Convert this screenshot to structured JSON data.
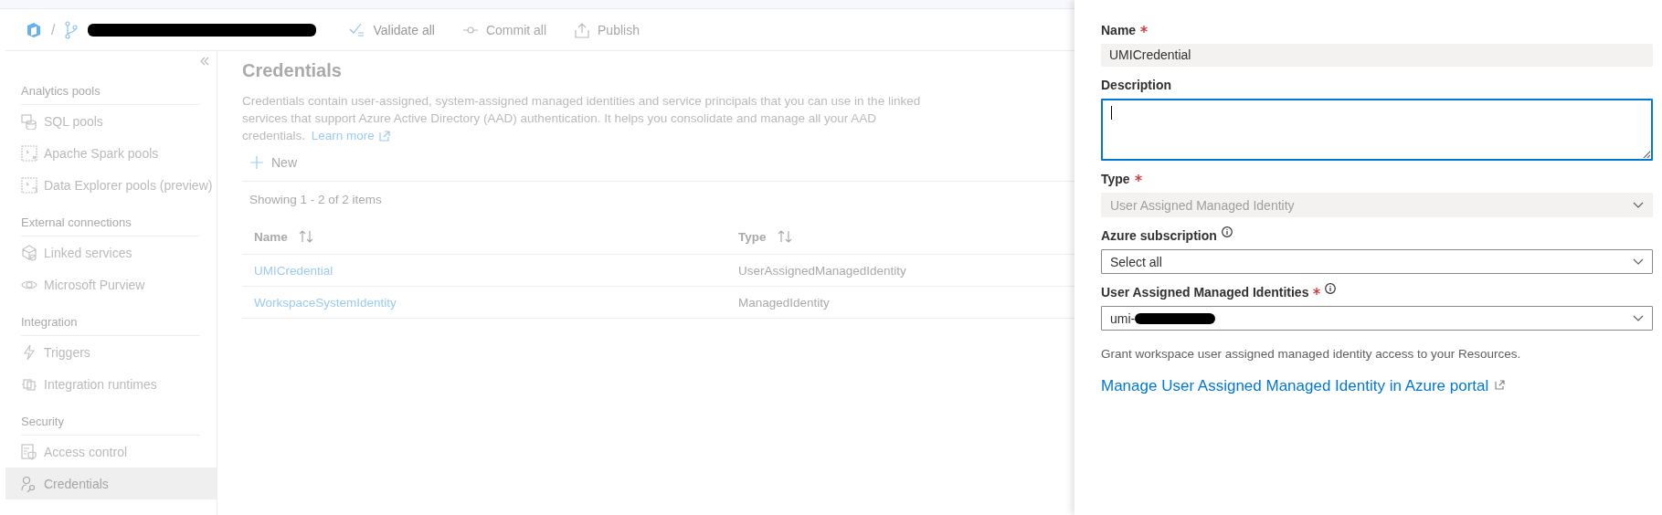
{
  "toolbar": {
    "separator": "/",
    "branch": {
      "redacted": true
    },
    "actions": [
      {
        "label": "Validate all",
        "disabled": false
      },
      {
        "label": "Commit all",
        "disabled": true
      },
      {
        "label": "Publish",
        "disabled": true
      }
    ]
  },
  "sidebar": {
    "groups": [
      {
        "title": "Analytics pools",
        "items": [
          {
            "label": "SQL pools",
            "selected": false
          },
          {
            "label": "Apache Spark pools",
            "selected": false
          },
          {
            "label": "Data Explorer pools (preview)",
            "selected": false
          }
        ]
      },
      {
        "title": "External connections",
        "items": [
          {
            "label": "Linked services",
            "selected": false
          },
          {
            "label": "Microsoft Purview",
            "selected": false
          }
        ]
      },
      {
        "title": "Integration",
        "items": [
          {
            "label": "Triggers",
            "selected": false
          },
          {
            "label": "Integration runtimes",
            "selected": false
          }
        ]
      },
      {
        "title": "Security",
        "items": [
          {
            "label": "Access control",
            "selected": false
          },
          {
            "label": "Credentials",
            "selected": true
          }
        ]
      }
    ]
  },
  "main": {
    "title": "Credentials",
    "description": "Credentials contain user-assigned, system-assigned managed identities and service principals that you can use in the linked services that support Azure Active Directory (AAD) authentication. It helps you consolidate and manage all your AAD credentials.",
    "learn_more": "Learn more",
    "new_button": "New",
    "count": "Showing 1 - 2 of 2 items",
    "table": {
      "columns": [
        "Name",
        "Type"
      ],
      "rows": [
        [
          "UMICredential",
          "UserAssignedManagedIdentity"
        ],
        [
          "WorkspaceSystemIdentity",
          "ManagedIdentity"
        ]
      ]
    }
  },
  "panel": {
    "fields": [
      {
        "kind": "readonly",
        "label": "Name",
        "required": true,
        "info": false,
        "value": "UMICredential"
      },
      {
        "kind": "textarea",
        "label": "Description",
        "required": false,
        "info": false,
        "focused": true
      },
      {
        "kind": "select",
        "label": "Type",
        "required": true,
        "info": false,
        "value": "User Assigned Managed Identity",
        "disabled": true
      },
      {
        "kind": "select",
        "label": "Azure subscription",
        "required": false,
        "info": true,
        "value": "Select all",
        "disabled": false
      },
      {
        "kind": "select",
        "label": "User Assigned Managed Identities",
        "required": true,
        "info": true,
        "value": "umi-",
        "redacted": true,
        "disabled": false
      }
    ],
    "note": "Grant workspace user assigned managed identity access to your Resources.",
    "link": "Manage User Assigned Managed Identity in Azure portal"
  }
}
